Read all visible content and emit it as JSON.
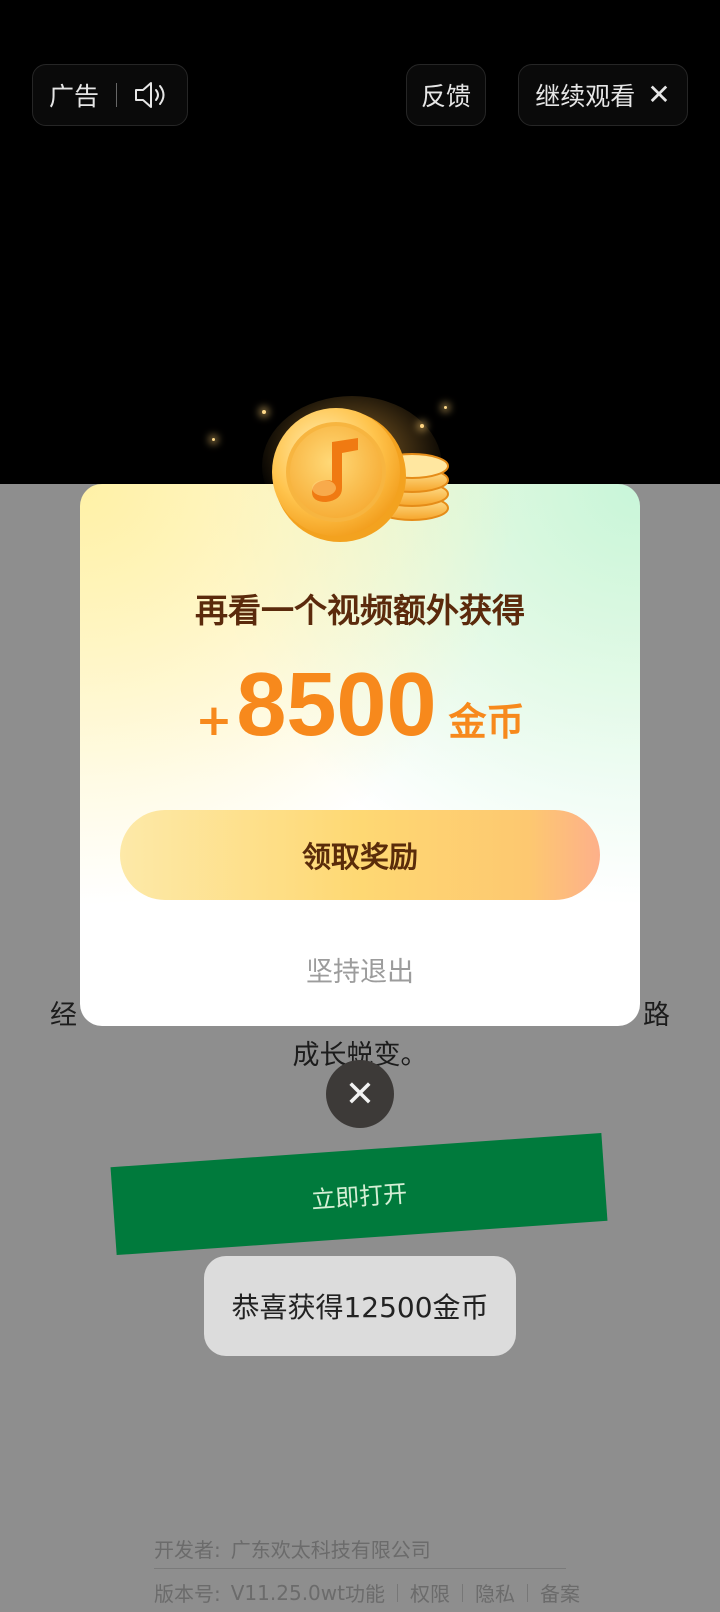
{
  "ad_bar": {
    "ad_label": "广告",
    "sound_icon": "speaker-icon",
    "feedback_label": "反馈",
    "continue_label": "继续观看",
    "close_icon": "close-icon"
  },
  "dialog": {
    "title": "再看一个视频额外获得",
    "plus": "+",
    "amount": "8500",
    "unit": "金币",
    "claim_label": "领取奖励",
    "quit_label": "坚持退出",
    "coin_icon": "gold-coin-icon"
  },
  "background_page": {
    "text_line1": "经",
    "text_line1_end": "路",
    "text_line2": "成长蜕变。",
    "close_icon": "close-icon",
    "open_button_label": "立即打开"
  },
  "toast": {
    "message": "恭喜获得12500金币"
  },
  "footer": {
    "developer_label": "开发者:",
    "developer": "广东欢太科技有限公司",
    "version_label": "版本号:",
    "version": "V11.25.0wt",
    "features_label": "功能",
    "permissions_label": "权限",
    "privacy_label": "隐私",
    "filing_label": "备案"
  },
  "colors": {
    "accent_orange": "#f7891c",
    "title_brown": "#5b2a0c",
    "open_button_green": "#007a3c"
  }
}
